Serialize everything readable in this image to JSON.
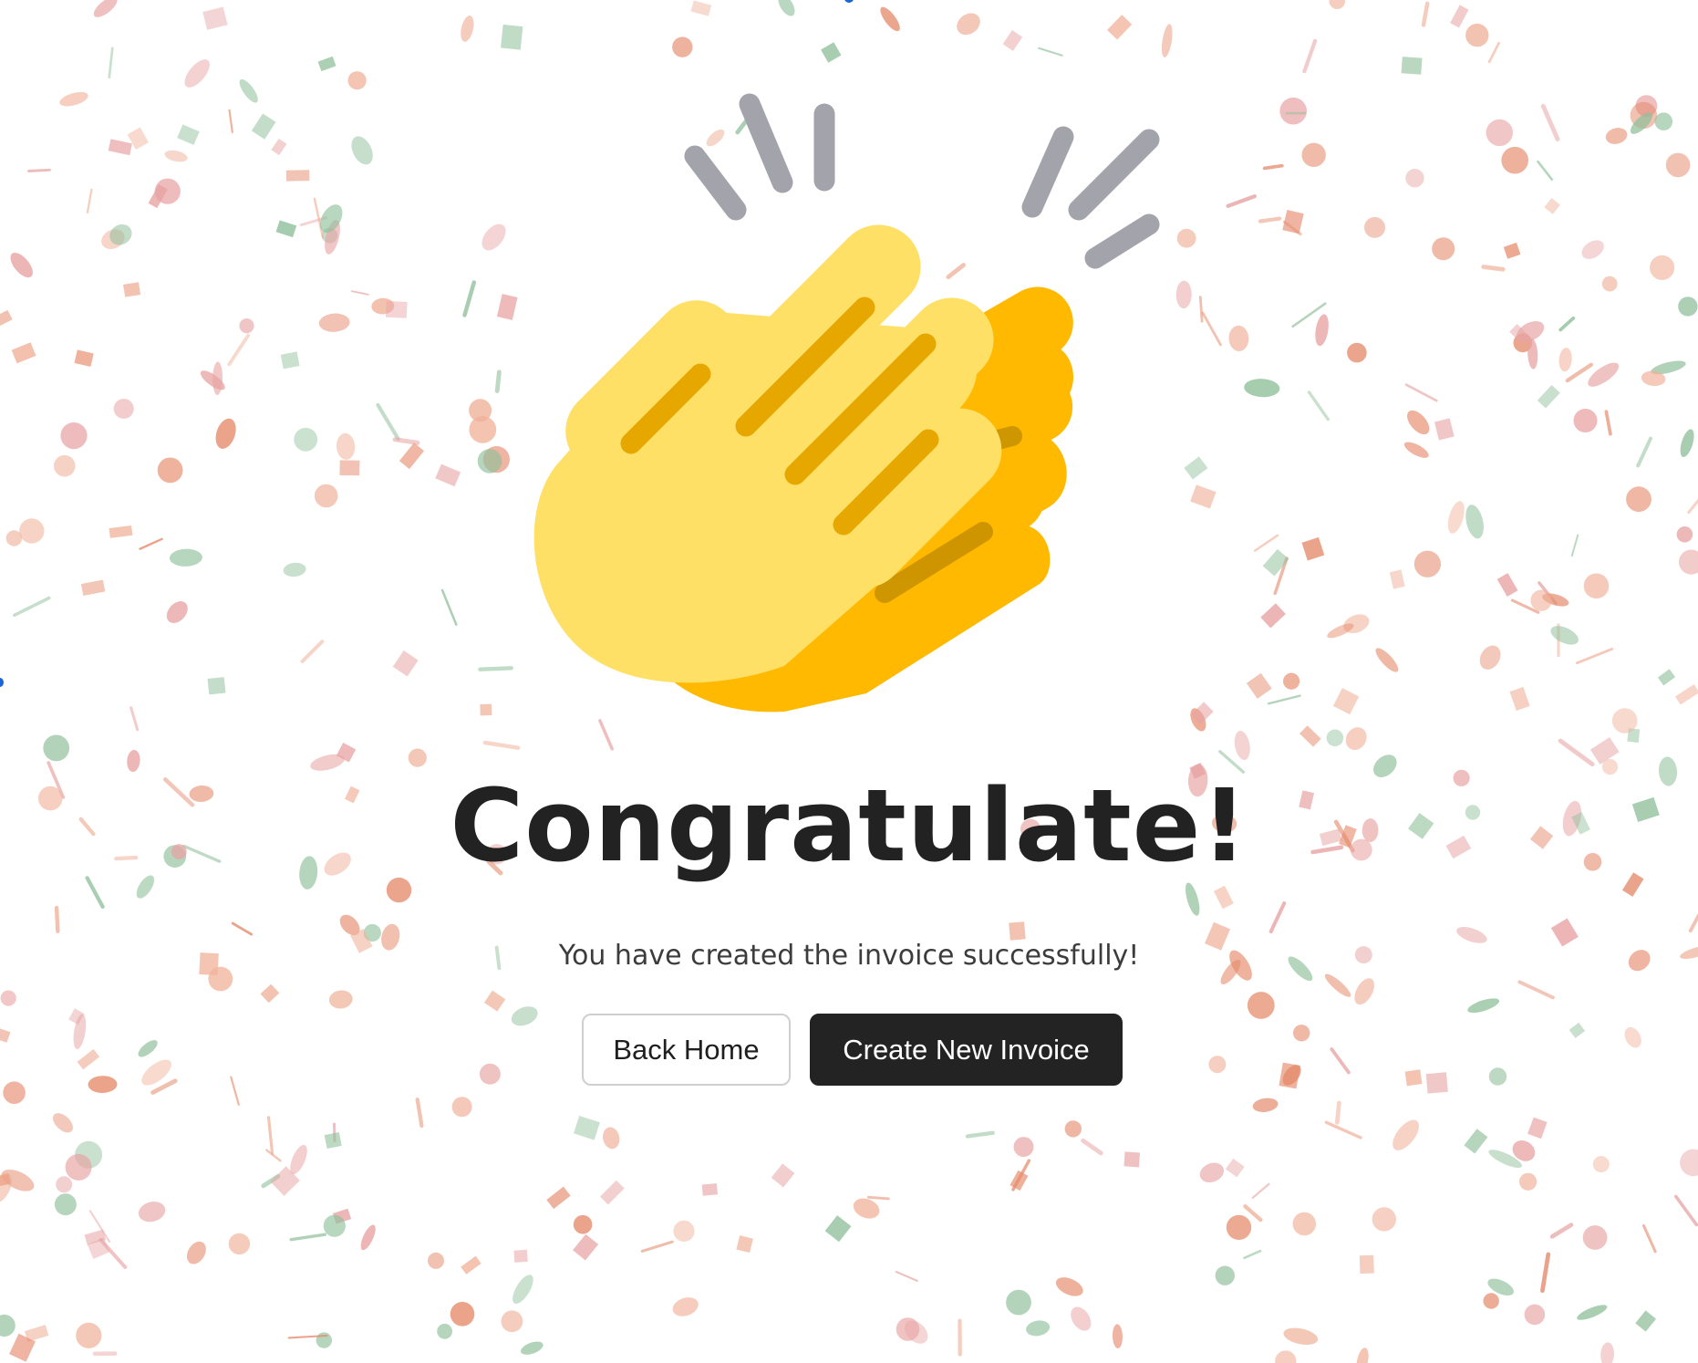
{
  "page": {
    "headline": "Congratulate!",
    "message": "You have created the invoice successfully!"
  },
  "actions": {
    "back_home_label": "Back Home",
    "create_new_invoice_label": "Create New Invoice"
  },
  "icons": {
    "hero": "clapping-hands-icon"
  },
  "colors": {
    "primary_button": "#232323",
    "headline": "#222222",
    "hand_front": "#FFE066",
    "hand_back": "#FFB900",
    "motion_lines": "#A3A3AB",
    "confetti": [
      "#e58a6b",
      "#e8a3a3",
      "#8fbf9a",
      "#f0b199"
    ]
  }
}
